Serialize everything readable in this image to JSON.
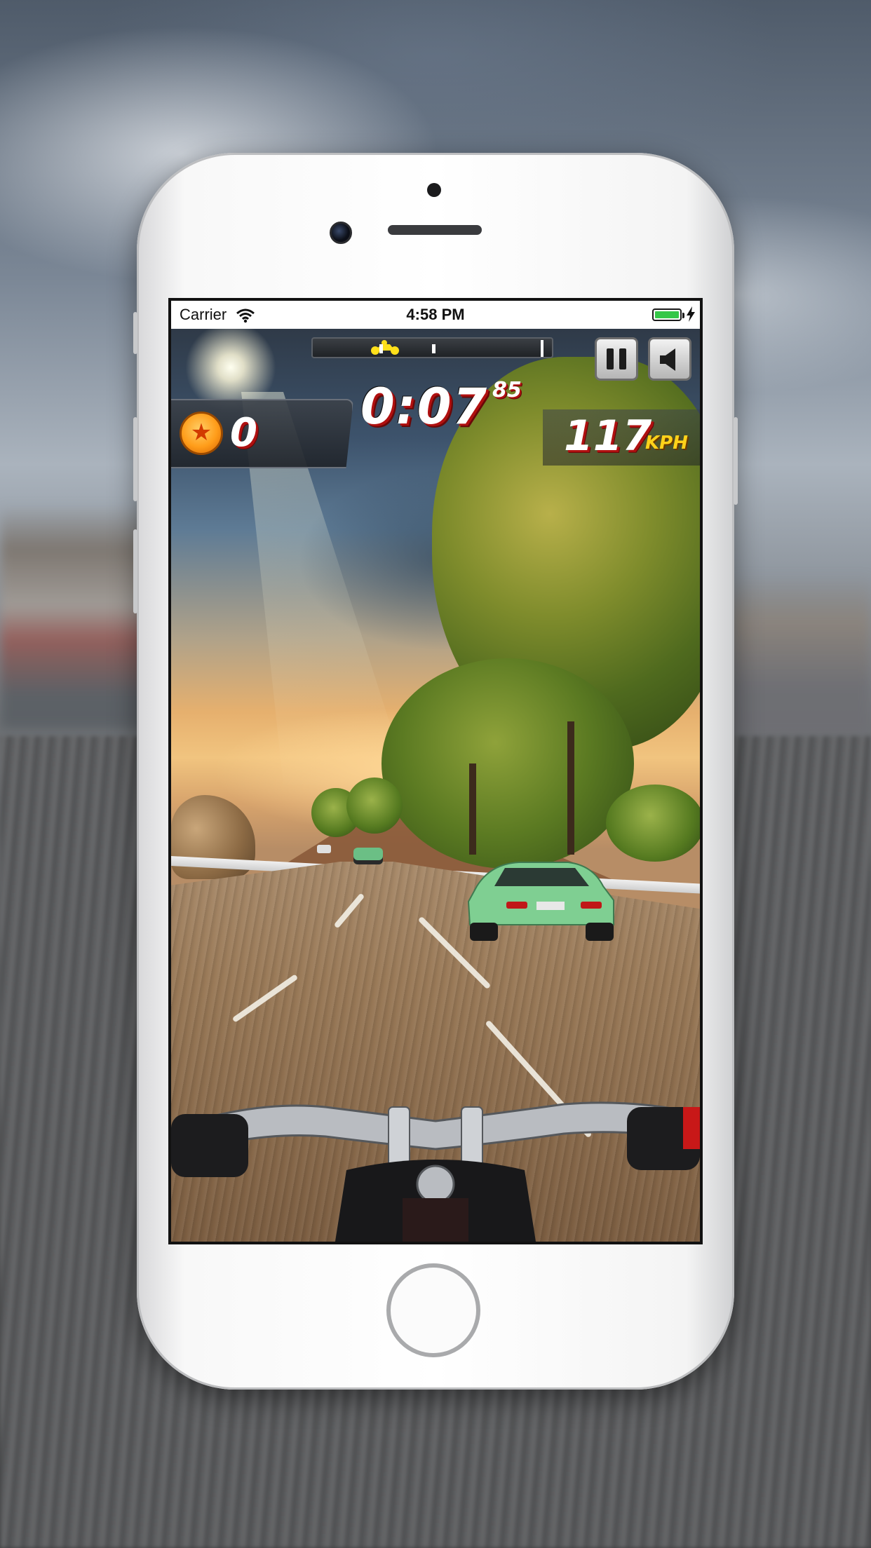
{
  "status_bar": {
    "carrier": "Carrier",
    "time": "4:58 PM",
    "battery_level": 1.0,
    "battery_color": "#35c748"
  },
  "hud": {
    "race_progress": 0.27,
    "timer_main": "0:07",
    "timer_fraction": "85",
    "coins": "0",
    "speed": "117",
    "speed_unit": "KPH",
    "pause_icon": "pause-icon",
    "sound_icon": "speaker-icon"
  },
  "colors": {
    "hud_digit_shadow": "#b01010",
    "speed_unit": "#ffd21a",
    "coin": "#ff9d1a"
  }
}
